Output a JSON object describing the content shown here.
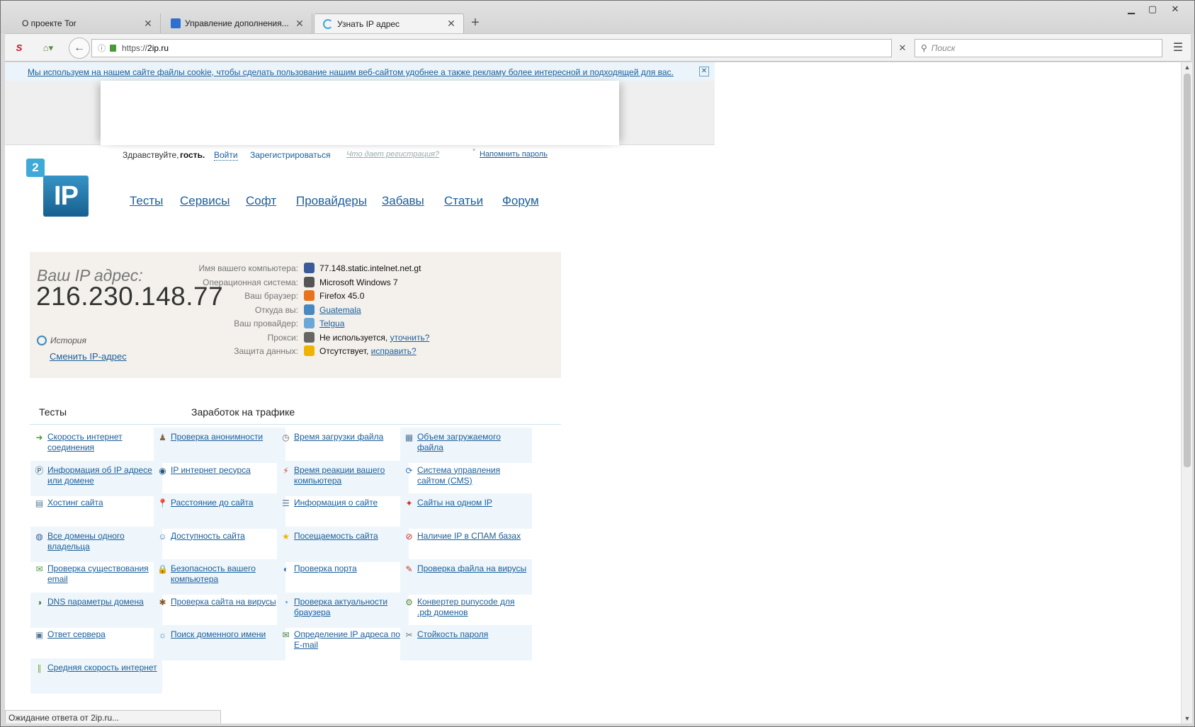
{
  "tabs": [
    {
      "label": "О проекте Tor"
    },
    {
      "label": "Управление дополнения..."
    },
    {
      "label": "Узнать IP адрес"
    }
  ],
  "url": {
    "scheme": "https://",
    "host": "2ip.ru"
  },
  "search": {
    "placeholder": "Поиск"
  },
  "cookie_text": "Мы используем на нашем сайте файлы cookie, чтобы сделать пользование нашим веб-сайтом удобнее а также рекламу более интересной и подходящей для вас.",
  "greeting": {
    "hello": "Здравствуйте,",
    "guest": "гость.",
    "login": "Войти",
    "register": "Зарегистрироваться",
    "why": "Что дает регистрация?",
    "remind": "Напомнить пароль"
  },
  "logo": {
    "small": "2",
    "big": "IP"
  },
  "menu": [
    "Тесты",
    "Сервисы",
    "Софт",
    "Провайдеры",
    "Забавы",
    "Статьи",
    "Форум"
  ],
  "ip": {
    "heading": "Ваш IP адрес:",
    "value": "216.230.148.77",
    "history": "История",
    "change": "Сменить IP-адрес"
  },
  "info": [
    {
      "label": "Имя вашего компьютера:",
      "value": "77.148.static.intelnet.net.gt",
      "link": "",
      "color": "#3a5a9a"
    },
    {
      "label": "Операционная система:",
      "value": "Microsoft Windows 7",
      "link": "",
      "color": "#555555"
    },
    {
      "label": "Ваш браузер:",
      "value": "Firefox 45.0",
      "link": "",
      "color": "#e8731c"
    },
    {
      "label": "Откуда вы:",
      "value": "",
      "link": "Guatemala",
      "color": "#4a88c0"
    },
    {
      "label": "Ваш провайдер:",
      "value": "",
      "link": "Telgua",
      "color": "#6aa8d8"
    },
    {
      "label": "Прокси:",
      "value": "Не используется,",
      "link": "уточнить?",
      "color": "#666666"
    },
    {
      "label": "Защита данных:",
      "value": "Отсутствует,",
      "link": "исправить?",
      "color": "#f0b400"
    }
  ],
  "sections": {
    "tests": "Тесты",
    "earn": "Заработок на трафике"
  },
  "services": [
    [
      "Скорость интернет соединения",
      "Проверка анонимности",
      "Время загрузки файла",
      "Объем загружаемого файла"
    ],
    [
      "Информация об IP адресе или домене",
      "IP интернет ресурса",
      "Время реакции вашего компьютера",
      "Система управления сайтом (CMS)"
    ],
    [
      "Хостинг сайта",
      "Расстояние до сайта",
      "Информация о сайте",
      "Сайты на одном IP"
    ],
    [
      "Все домены одного владельца",
      "Доступность сайта",
      "Посещаемость сайта",
      "Наличие IP в СПАМ базах"
    ],
    [
      "Проверка существования email",
      "Безопасность вашего компьютера",
      "Проверка порта",
      "Проверка файла на вирусы"
    ],
    [
      "DNS параметры домена",
      "Проверка сайта на вирусы",
      "Проверка актуальности браузера",
      "Конвертер punycode для .рф доменов"
    ],
    [
      "Ответ сервера",
      "Поиск доменного имени",
      "Определение IP адреса по E-mail",
      "Стойкость пароля"
    ],
    [
      "Средняя скорость интернет",
      "",
      "",
      ""
    ]
  ],
  "status": "Ожидание ответа от 2ip.ru...",
  "colors": {
    "link": "#1b5e9a",
    "ipbox": "#f4f1ec",
    "cookie_bg": "#eaf4fa",
    "cell_shade": "#eef6fb"
  }
}
